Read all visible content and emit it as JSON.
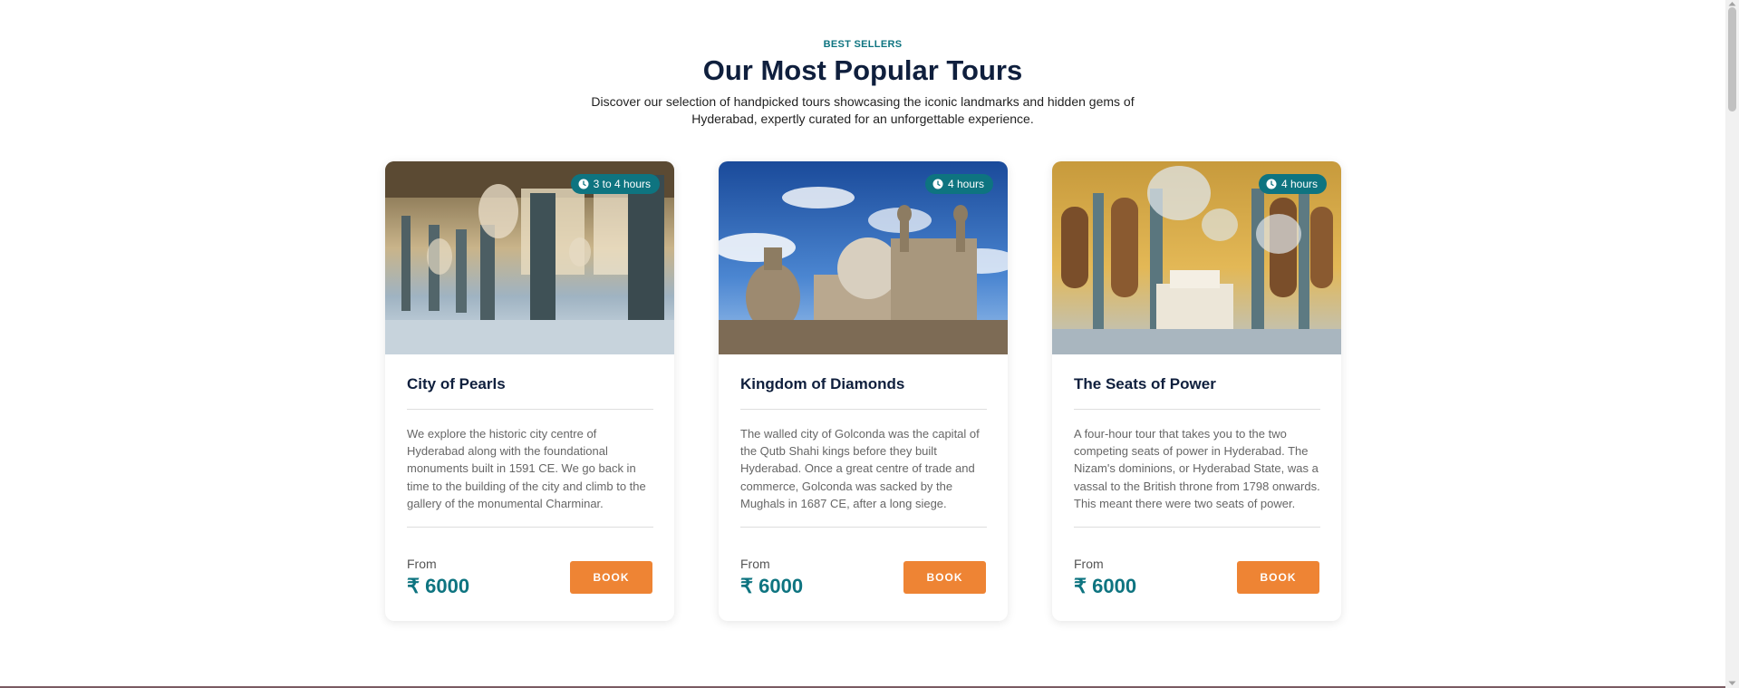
{
  "section": {
    "eyebrow": "BEST SELLERS",
    "title": "Our Most Popular Tours",
    "intro": "Discover our selection of handpicked tours showcasing the iconic landmarks and hidden gems of Hyderabad, expertly curated for an unforgettable experience."
  },
  "tours": [
    {
      "duration": "3 to 4 hours",
      "title": "City of Pearls",
      "description": "We explore the historic city centre of Hyderabad along with the foundational monuments built in 1591 CE. We go back in time to the building of the city and climb to the gallery of the monumental Charminar.",
      "from_label": "From",
      "price": "₹ 6000",
      "book_label": "BOOK"
    },
    {
      "duration": "4 hours",
      "title": "Kingdom of Diamonds",
      "description": "The walled city of Golconda was the capital of the Qutb Shahi kings before they built Hyderabad. Once a great centre of trade and commerce, Golconda was sacked by the Mughals in 1687 CE, after a long siege.",
      "from_label": "From",
      "price": "₹ 6000",
      "book_label": "BOOK"
    },
    {
      "duration": "4 hours",
      "title": "The Seats of Power",
      "description": "A four-hour tour that takes you to the two competing seats of power in Hyderabad. The Nizam's dominions, or Hyderabad State, was a vassal to the British throne from 1798 onwards. This meant there were two seats of power.",
      "from_label": "From",
      "price": "₹ 6000",
      "book_label": "BOOK"
    }
  ],
  "icons": {
    "duration": "clock-icon"
  },
  "colors": {
    "accent": "#0e7480",
    "heading": "#0f1f3d",
    "button": "#ee8434"
  }
}
